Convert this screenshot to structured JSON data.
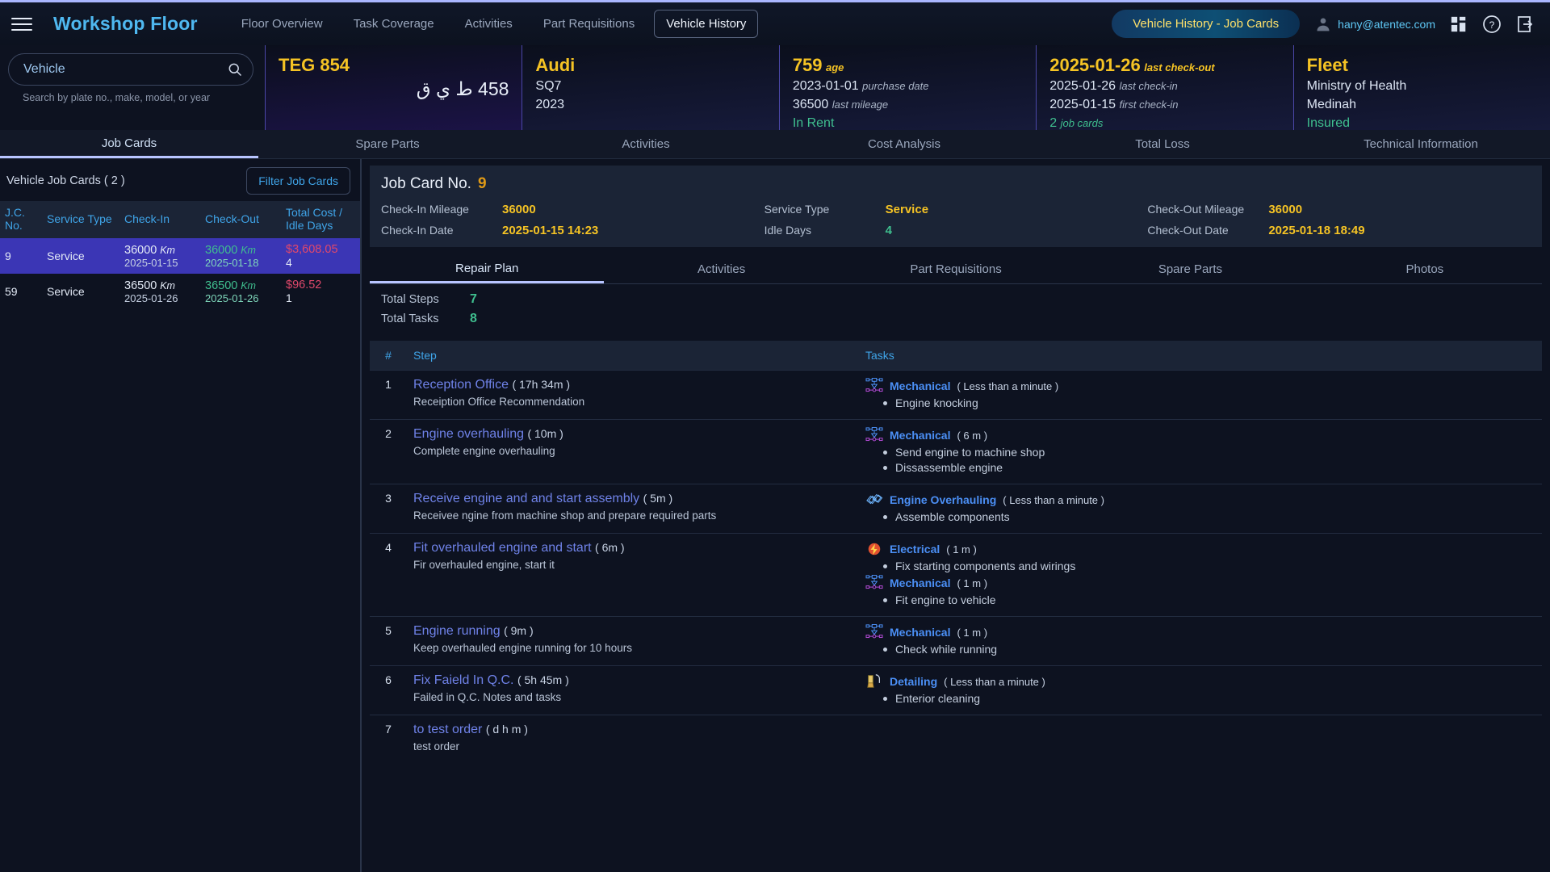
{
  "topbar": {
    "menu_icon": "hamburger-icon",
    "brand": "Workshop Floor",
    "nav": [
      {
        "label": "Floor Overview",
        "active": false
      },
      {
        "label": "Task Coverage",
        "active": false
      },
      {
        "label": "Activities",
        "active": false
      },
      {
        "label": "Part Requisitions",
        "active": false
      },
      {
        "label": "Vehicle History",
        "active": true
      }
    ],
    "page_pill": "Vehicle History - Job Cards",
    "user_email": "hany@atentec.com",
    "user_icon": "user-avatar-icon",
    "apps_icon": "apps-grid-icon",
    "help_icon": "help-circle-icon",
    "logout_icon": "logout-icon"
  },
  "search": {
    "value": "Vehicle",
    "placeholder": "Vehicle",
    "icon": "search-icon",
    "hint": "Search by plate no., make, model, or year"
  },
  "vehicle_cards": [
    {
      "name": "plate-card",
      "title": "TEG 854",
      "arabic_plate": "854 ط ي ق"
    },
    {
      "name": "make-card",
      "title": "Audi",
      "rows": [
        {
          "value": "SQ7",
          "label": ""
        },
        {
          "value": "2023",
          "label": ""
        }
      ]
    },
    {
      "name": "age-card",
      "title": "759",
      "title_label": "age",
      "rows": [
        {
          "value": "2023-01-01",
          "label": "purchase date"
        },
        {
          "value": "36500",
          "label": "last mileage"
        }
      ],
      "status": "In Rent"
    },
    {
      "name": "checkin-card",
      "title": "2025-01-26",
      "title_label": "last check-out",
      "rows": [
        {
          "value": "2025-01-26",
          "label": "last check-in"
        },
        {
          "value": "2025-01-15",
          "label": "first check-in"
        }
      ],
      "status": "2",
      "status_label": "job cards"
    },
    {
      "name": "fleet-card",
      "title": "Fleet",
      "rows": [
        {
          "value": "Ministry of Health",
          "label": ""
        },
        {
          "value": "Medinah",
          "label": ""
        }
      ],
      "status": "Insured"
    }
  ],
  "main_tabs": [
    {
      "label": "Job Cards",
      "active": true
    },
    {
      "label": "Spare Parts",
      "active": false
    },
    {
      "label": "Activities",
      "active": false
    },
    {
      "label": "Cost Analysis",
      "active": false
    },
    {
      "label": "Total Loss",
      "active": false
    },
    {
      "label": "Technical Information",
      "active": false
    }
  ],
  "job_cards_panel": {
    "count_label": "Vehicle Job Cards ( 2 )",
    "filter_button": "Filter Job Cards",
    "columns": [
      "J.C. No.",
      "Service Type",
      "Check-In",
      "Check-Out",
      "Total Cost / Idle Days"
    ],
    "rows": [
      {
        "jc_no": "9",
        "service_type": "Service",
        "checkin_km": "36000",
        "checkin_unit": "Km",
        "checkin_date": "2025-01-15",
        "checkout_km": "36000",
        "checkout_unit": "Km",
        "checkout_date": "2025-01-18",
        "total_cost": "$3,608.05",
        "idle_days": "4",
        "selected": true
      },
      {
        "jc_no": "59",
        "service_type": "Service",
        "checkin_km": "36500",
        "checkin_unit": "Km",
        "checkin_date": "2025-01-26",
        "checkout_km": "36500",
        "checkout_unit": "Km",
        "checkout_date": "2025-01-26",
        "total_cost": "$96.52",
        "idle_days": "1",
        "selected": false
      }
    ]
  },
  "detail": {
    "title": "Job Card No.",
    "title_value": "9",
    "fields": [
      {
        "key": "Check-In Mileage",
        "value": "36000"
      },
      {
        "key": "Service Type",
        "value": "Service"
      },
      {
        "key": "Check-Out Mileage",
        "value": "36000"
      },
      {
        "key": "Check-In Date",
        "value": "2025-01-15 14:23"
      },
      {
        "key": "Idle Days",
        "value": "4",
        "green": true
      },
      {
        "key": "Check-Out Date",
        "value": "2025-01-18 18:49"
      }
    ],
    "sub_tabs": [
      {
        "label": "Repair Plan",
        "active": true
      },
      {
        "label": "Activities",
        "active": false
      },
      {
        "label": "Part Requisitions",
        "active": false
      },
      {
        "label": "Spare Parts",
        "active": false
      },
      {
        "label": "Photos",
        "active": false
      }
    ],
    "totals": [
      {
        "key": "Total Steps",
        "value": "7"
      },
      {
        "key": "Total Tasks",
        "value": "8"
      }
    ],
    "step_columns": [
      "#",
      "Step",
      "Tasks"
    ],
    "steps": [
      {
        "num": "1",
        "name": "Reception Office",
        "duration": "( 17h 34m )",
        "desc": "Receiption Office Recommendation",
        "tasks": [
          {
            "icon": "mechanical-gear-icon",
            "type": "Mechanical",
            "duration": "( Less than a minute )",
            "items": [
              "Engine knocking"
            ]
          }
        ]
      },
      {
        "num": "2",
        "name": "Engine overhauling",
        "duration": "( 10m )",
        "desc": "Complete engine overhauling",
        "tasks": [
          {
            "icon": "mechanical-gear-icon",
            "type": "Mechanical",
            "duration": "( 6 m )",
            "items": [
              "Send engine to machine shop",
              "Dissassemble engine"
            ]
          }
        ]
      },
      {
        "num": "3",
        "name": "Receive engine and and start assembly",
        "duration": "( 5m )",
        "desc": "Receivee ngine from machine shop and prepare required parts",
        "tasks": [
          {
            "icon": "engine-overhauling-icon",
            "type": "Engine Overhauling",
            "duration": "( Less than a minute )",
            "items": [
              "Assemble components"
            ]
          }
        ]
      },
      {
        "num": "4",
        "name": "Fit overhauled engine and start",
        "duration": "( 6m )",
        "desc": "Fir overhauled engine, start it",
        "tasks": [
          {
            "icon": "electrical-spark-icon",
            "type": "Electrical",
            "duration": "( 1 m )",
            "items": [
              "Fix starting components and wirings"
            ]
          },
          {
            "icon": "mechanical-gear-icon",
            "type": "Mechanical",
            "duration": "( 1 m )",
            "items": [
              "Fit engine to vehicle"
            ]
          }
        ]
      },
      {
        "num": "5",
        "name": "Engine running",
        "duration": "( 9m )",
        "desc": "Keep overhauled engine running for 10 hours",
        "tasks": [
          {
            "icon": "mechanical-gear-icon",
            "type": "Mechanical",
            "duration": "( 1 m )",
            "items": [
              "Check while running"
            ]
          }
        ]
      },
      {
        "num": "6",
        "name": "Fix Faield In Q.C.",
        "duration": "( 5h 45m )",
        "desc": "Failed in Q.C. Notes and tasks",
        "tasks": [
          {
            "icon": "detailing-brush-icon",
            "type": "Detailing",
            "duration": "( Less than a minute )",
            "items": [
              "Enterior cleaning"
            ]
          }
        ]
      },
      {
        "num": "7",
        "name": "to test order",
        "duration": "( d h m )",
        "desc": "test order",
        "tasks": []
      }
    ]
  },
  "colors": {
    "accent_gold": "#f5c324",
    "accent_blue": "#4fb8f0",
    "link_blue": "#6f82e8",
    "green": "#3fbf8f",
    "cost_red": "#e0486b",
    "selected_row": "#3b36b5",
    "panel_bg": "#1b2436",
    "page_bg": "#0d1220"
  }
}
